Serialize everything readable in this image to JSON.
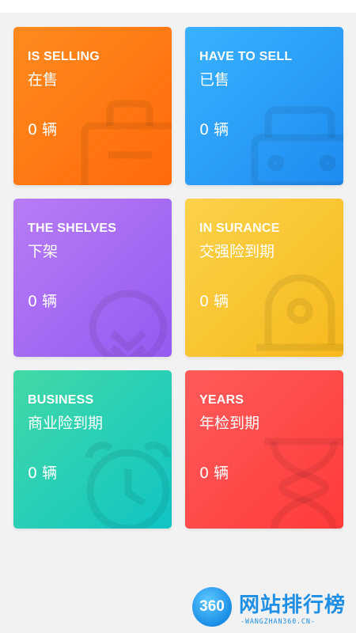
{
  "cards": [
    {
      "en": "IS SELLING",
      "zh": "在售",
      "count": "0 辆",
      "icon": "briefcase-icon"
    },
    {
      "en": "HAVE TO SELL",
      "zh": "已售",
      "count": "0 辆",
      "icon": "truck-icon"
    },
    {
      "en": "THE SHELVES",
      "zh": "下架",
      "count": "0 辆",
      "icon": "down-arrow-circle-icon"
    },
    {
      "en": "IN SURANCE",
      "zh": "交强险到期",
      "count": "0 辆",
      "icon": "bell-icon"
    },
    {
      "en": "BUSINESS",
      "zh": "商业险到期",
      "count": "0 辆",
      "icon": "alarm-clock-icon"
    },
    {
      "en": "YEARS",
      "zh": "年检到期",
      "count": "0 辆",
      "icon": "hourglass-icon"
    }
  ],
  "watermark": {
    "logo_text": "360",
    "title": "网站排行榜",
    "url": "-WANGZHAN360.CN-"
  },
  "colors": {
    "background": "#f2f2f3",
    "is_selling": "#ff7a14",
    "have_to_sell": "#2a9ff8",
    "the_shelves": "#a66bf3",
    "in_surance": "#f9c534",
    "business": "#2ccfb6",
    "years": "#ff4a4a"
  }
}
